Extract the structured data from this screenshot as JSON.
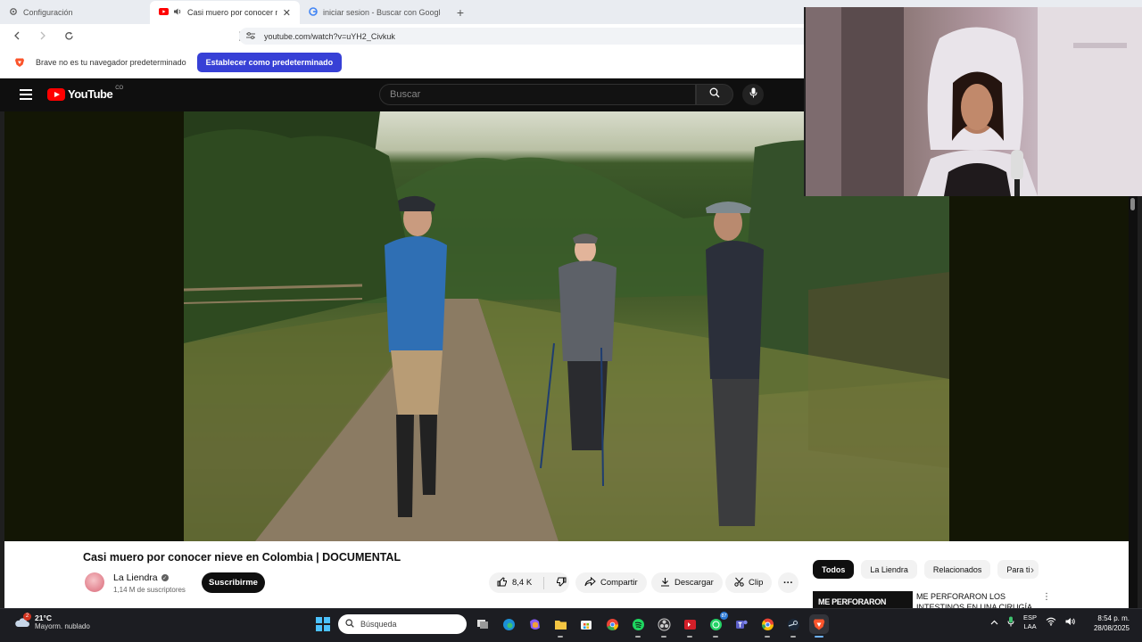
{
  "browser": {
    "tabs": [
      {
        "title": "Configuración",
        "icon": "gear-icon"
      },
      {
        "title": "Casi muero por conocer nieve en",
        "icon": "youtube-icon",
        "active": true
      },
      {
        "title": "iniciar sesion - Buscar con Google",
        "icon": "google-icon"
      }
    ],
    "url": "youtube.com/watch?v=uYH2_Civkuk",
    "infobar": {
      "message": "Brave no es tu navegador predeterminado",
      "button": "Establecer como predeterminado"
    }
  },
  "youtube": {
    "logo_text": "YouTube",
    "logo_region": "CO",
    "search_placeholder": "Buscar",
    "video": {
      "title": "Casi muero por conocer nieve en Colombia | DOCUMENTAL",
      "channel": "La Liendra",
      "subscribers": "1,14 M de suscriptores",
      "subscribe_label": "Suscribirme",
      "likes": "8,4 K",
      "share_label": "Compartir",
      "download_label": "Descargar",
      "clip_label": "Clip"
    },
    "chips": [
      "Todos",
      "La Liendra",
      "Relacionados",
      "Para ti"
    ],
    "recommendation": {
      "thumb_text": "ME PERFORARON",
      "title": "ME PERFORARON LOS INTESTINOS EN UNA CIRUGÍA"
    }
  },
  "taskbar": {
    "weather_badge": "2",
    "temperature": "21°C",
    "weather_desc": "Mayorm. nublado",
    "search_placeholder": "Búsqueda",
    "whatsapp_badge": "87",
    "lang_line1": "ESP",
    "lang_line2": "LAA",
    "time": "8:54 p. m.",
    "date": "28/08/2025"
  },
  "colors": {
    "brave_button": "#3740d6",
    "youtube_red": "#ff0000",
    "taskbar": "#1c1d22"
  }
}
